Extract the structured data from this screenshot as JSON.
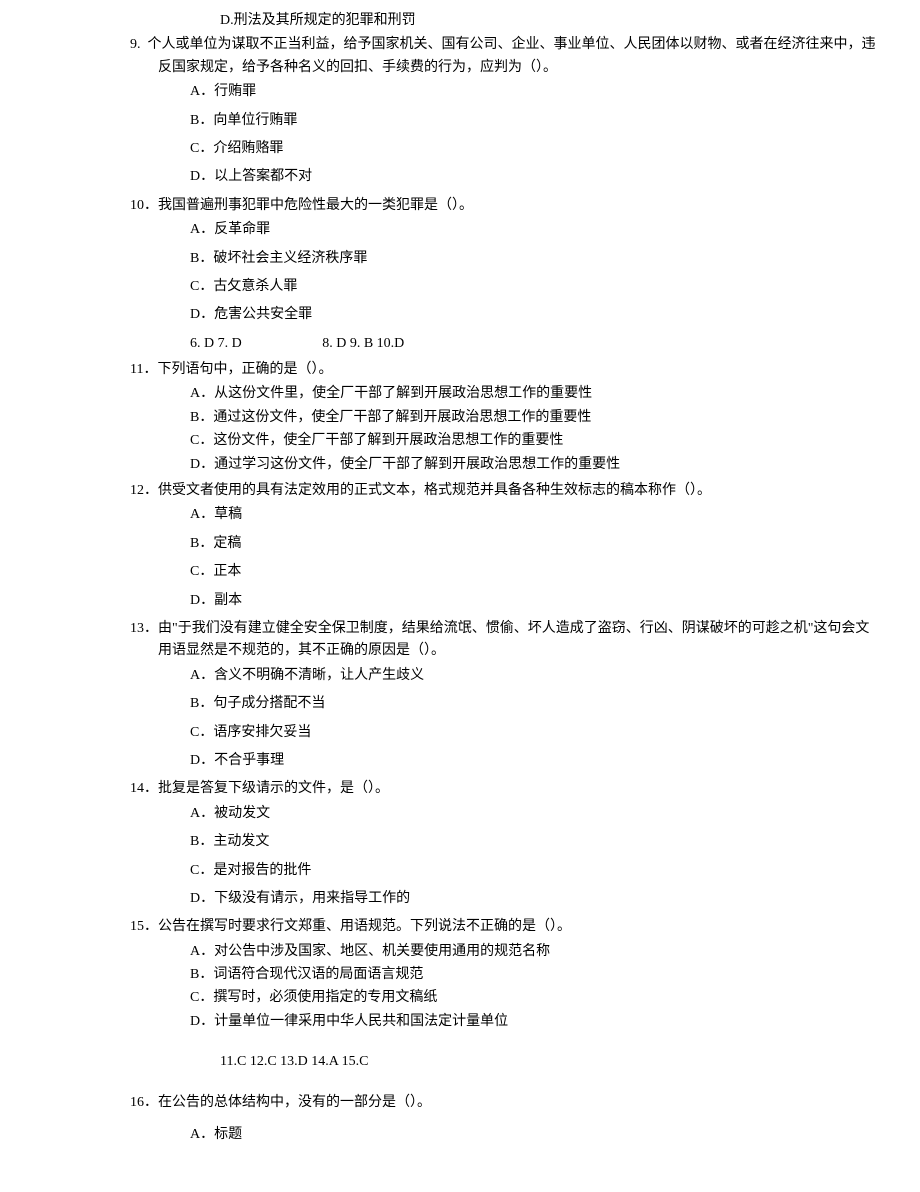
{
  "q8_optD": "D.刑法及其所规定的犯罪和刑罚",
  "q9": {
    "num": "9.",
    "stem": "个人或单位为谋取不正当利益，给予国家机关、国有公司、企业、事业单位、人民团体以财物、或者在经济往来中，违反国家规定，给予各种名义的回扣、手续费的行为，应判为（）。",
    "A": "A．行贿罪",
    "B": "B．向单位行贿罪",
    "C": "C．介绍贿赂罪",
    "D": "D．以上答案都不对"
  },
  "q10": {
    "num": "10．",
    "stem": "我国普遍刑事犯罪中危险性最大的一类犯罪是（）。",
    "A": "A．反革命罪",
    "B": "B．破坏社会主义经济秩序罪",
    "C": "C．古攵意杀人罪",
    "D": "D．危害公共安全罪"
  },
  "answers1": "6. D 7. D                       8. D 9. B 10.D",
  "q11": {
    "num": "11．",
    "stem": "下列语句中，正确的是（）。",
    "A": "A．从这份文件里，使全厂干部了解到开展政治思想工作的重要性",
    "B": "B．通过这份文件，使全厂干部了解到开展政治思想工作的重要性",
    "C": "C．这份文件，使全厂干部了解到开展政治思想工作的重要性",
    "D": "D．通过学习这份文件，使全厂干部了解到开展政治思想工作的重要性"
  },
  "q12": {
    "num": "12．",
    "stem": "供受文者使用的具有法定效用的正式文本，格式规范并具备各种生效标志的稿本称作（）。",
    "A": "A．草稿",
    "B": "B．定稿",
    "C": "C．正本",
    "D": "D．副本"
  },
  "q13": {
    "num": "13．",
    "stem": "由\"于我们没有建立健全安全保卫制度，结果给流氓、惯偷、坏人造成了盗窃、行凶、阴谋破坏的可趁之机\"这句会文用语显然是不规范的，其不正确的原因是（）。",
    "A": "A．含义不明确不清晰，让人产生歧义",
    "B": "B．句子成分搭配不当",
    "C": "C．语序安排欠妥当",
    "D": "D．不合乎事理"
  },
  "q14": {
    "num": "14．",
    "stem": "批复是答复下级请示的文件，是（）。",
    "A": "A．被动发文",
    "B": "B．主动发文",
    "C": "C．是对报告的批件",
    "D": "D．下级没有请示，用来指导工作的"
  },
  "q15": {
    "num": "15．",
    "stem": "公告在撰写时要求行文郑重、用语规范。下列说法不正确的是（）。",
    "A": "A．对公告中涉及国家、地区、机关要使用通用的规范名称",
    "B": "B．词语符合现代汉语的局面语言规范",
    "C": "C．撰写时，必须使用指定的专用文稿纸",
    "D": "D．计量单位一律采用中华人民共和国法定计量单位"
  },
  "answers2": "11.C 12.C 13.D 14.A 15.C",
  "q16": {
    "num": "16．",
    "stem": "在公告的总体结构中，没有的一部分是（）。",
    "A": "A．标题"
  }
}
